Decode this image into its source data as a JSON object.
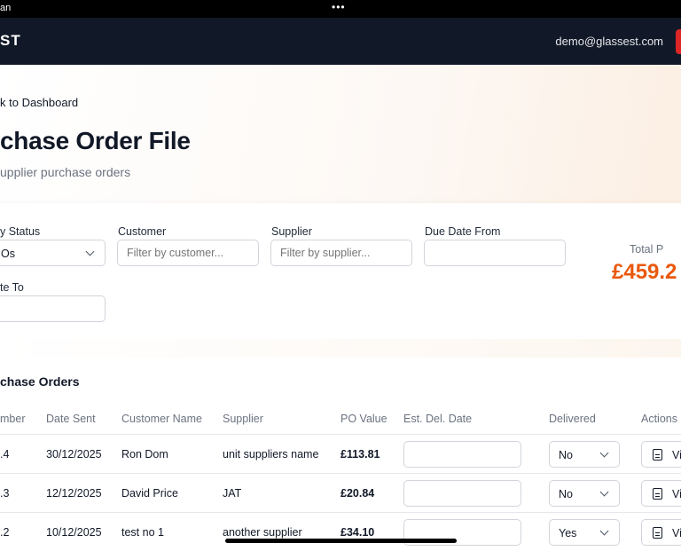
{
  "statusbar": {
    "left_text": "an",
    "dots": "•••"
  },
  "navbar": {
    "brand": "ST",
    "email": "demo@glassest.com"
  },
  "hero": {
    "back_link": "k to Dashboard",
    "title": "chase Order File",
    "subtitle": "upplier purchase orders"
  },
  "filters": {
    "status_label": "y Status",
    "status_value": "Os",
    "customer_label": "Customer",
    "customer_placeholder": "Filter by customer...",
    "supplier_label": "Supplier",
    "supplier_placeholder": "Filter by supplier...",
    "due_from_label": "Due Date From",
    "due_to_label": "te To",
    "total_label": "Total P",
    "total_value": "£459.2"
  },
  "orders": {
    "title": "chase Orders",
    "headers": [
      "mber",
      "Date Sent",
      "Customer Name",
      "Supplier",
      "PO Value",
      "Est. Del. Date",
      "Delivered",
      "Actions"
    ],
    "rows": [
      {
        "number": ".4",
        "date_sent": "30/12/2025",
        "customer": "Ron Dom",
        "supplier": "unit suppliers name",
        "po_value": "£113.81",
        "delivered": "No",
        "action": "Vi"
      },
      {
        "number": ".3",
        "date_sent": "12/12/2025",
        "customer": "David Price",
        "supplier": "JAT",
        "po_value": "£20.84",
        "delivered": "No",
        "action": "Vi"
      },
      {
        "number": ".2",
        "date_sent": "10/12/2025",
        "customer": "test no 1",
        "supplier": "another supplier",
        "po_value": "£34.10",
        "delivered": "Yes",
        "action": "Vi"
      }
    ]
  },
  "colors": {
    "navbar": "#111827",
    "accent": "#ea580c",
    "danger": "#dc2626"
  }
}
